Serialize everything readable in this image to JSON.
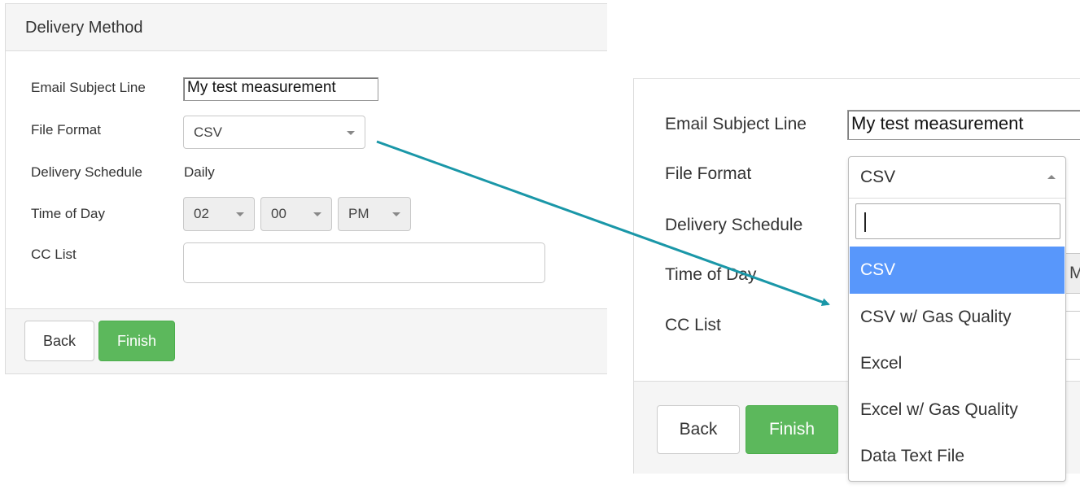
{
  "left_panel": {
    "title": "Delivery Method",
    "fields": {
      "email_subject_label": "Email Subject Line",
      "email_subject_value": "My test measurement",
      "file_format_label": "File Format",
      "file_format_value": "CSV",
      "delivery_schedule_label": "Delivery Schedule",
      "delivery_schedule_value": "Daily",
      "time_of_day_label": "Time of Day",
      "time_hour": "02",
      "time_minute": "00",
      "time_ampm": "PM",
      "cc_list_label": "CC List",
      "cc_list_value": ""
    },
    "buttons": {
      "back": "Back",
      "finish": "Finish"
    }
  },
  "right_panel": {
    "fields": {
      "email_subject_label": "Email Subject Line",
      "email_subject_value": "My test measurement",
      "file_format_label": "File Format",
      "file_format_value": "CSV",
      "delivery_schedule_label": "Delivery Schedule",
      "time_of_day_label": "Time of Day",
      "time_partial": "M",
      "cc_list_label": "CC List"
    },
    "dropdown": {
      "search_value": "",
      "options": [
        "CSV",
        "CSV w/ Gas Quality",
        "Excel",
        "Excel w/ Gas Quality",
        "Data Text File"
      ],
      "highlighted": "CSV"
    },
    "buttons": {
      "back": "Back",
      "finish": "Finish"
    }
  },
  "colors": {
    "arrow": "#1a97a8",
    "success": "#5cb85c",
    "highlight": "#5897fb",
    "panel_heading_bg": "#f5f5f5"
  }
}
